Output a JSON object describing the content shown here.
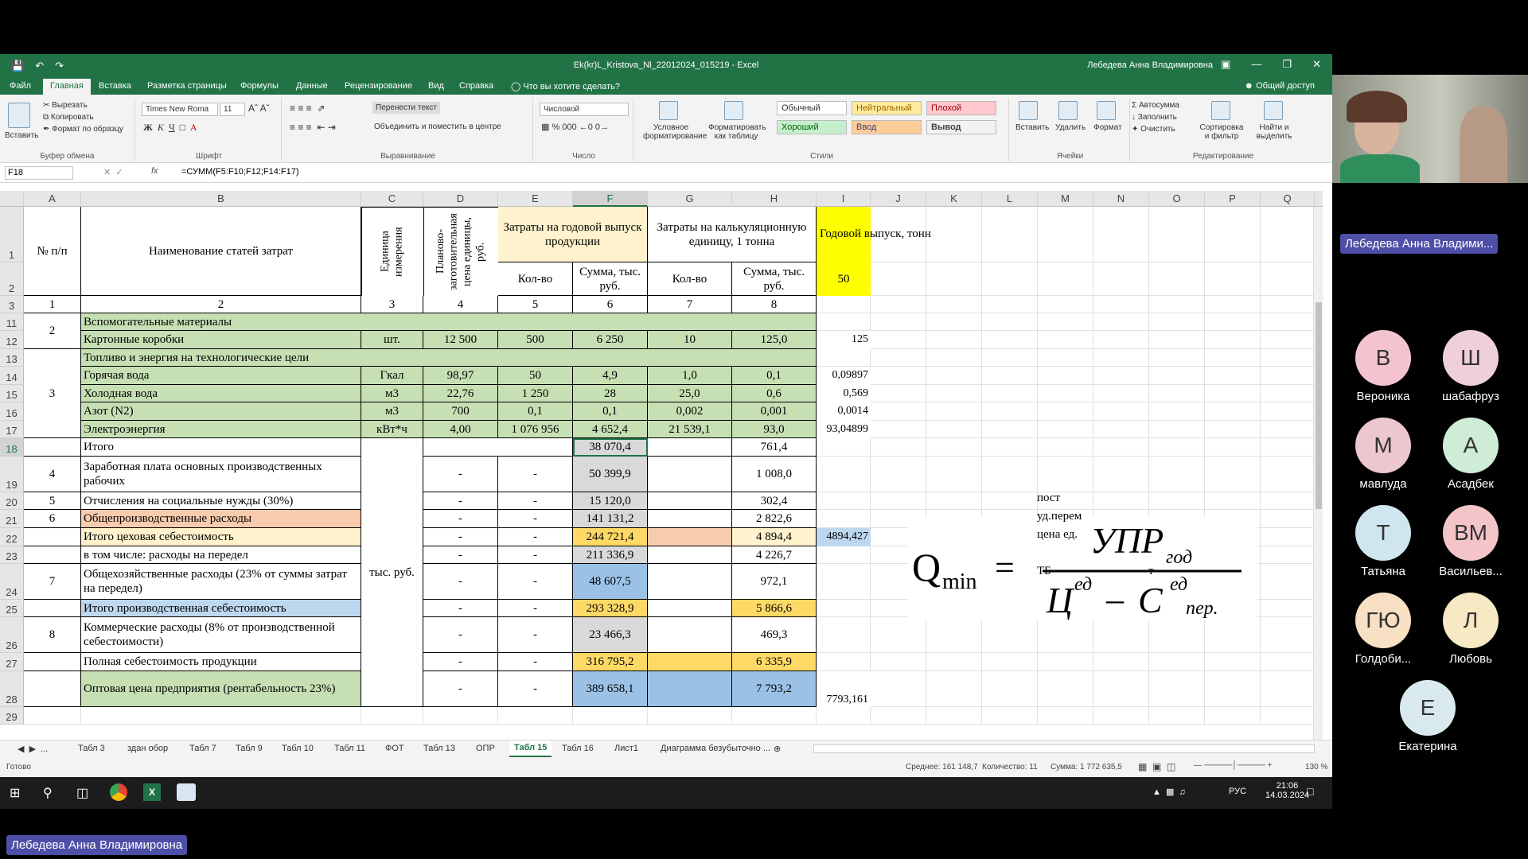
{
  "window": {
    "title": "Ek(kr)L_Kristova_Nl_22012024_015219  -  Excel",
    "user": "Лебедева Анна Владимировна"
  },
  "menu_tabs": [
    "Файл",
    "Главная",
    "Вставка",
    "Разметка страницы",
    "Формулы",
    "Данные",
    "Рецензирование",
    "Вид",
    "Справка",
    "Что вы хотите сделать?"
  ],
  "share": "Общий доступ",
  "ribbon": {
    "clipboard": {
      "paste": "Вставить",
      "cut": "Вырезать",
      "copy": "Копировать",
      "format_painter": "Формат по образцу",
      "label": "Буфер обмена"
    },
    "font": {
      "name": "Times New Roma",
      "size": "11",
      "label": "Шрифт"
    },
    "alignment": {
      "wrap": "Перенести текст",
      "merge": "Объединить и поместить в центре",
      "label": "Выравнивание"
    },
    "number": {
      "format": "Числовой",
      "label": "Число"
    },
    "styles": {
      "cond": "Условное форматирование",
      "table": "Форматировать как таблицу",
      "normal": "Обычный",
      "neutral": "Нейтральный",
      "bad": "Плохой",
      "good": "Хороший",
      "input": "Ввод",
      "output": "Вывод",
      "label": "Стили"
    },
    "cells": {
      "insert": "Вставить",
      "delete": "Удалить",
      "format": "Формат",
      "label": "Ячейки"
    },
    "editing": {
      "autosum": "Автосумма",
      "fill": "Заполнить",
      "clear": "Очистить",
      "sort": "Сортировка и фильтр",
      "find": "Найти и выделить",
      "label": "Редактирование"
    }
  },
  "formula_bar": {
    "cell": "F18",
    "fx": "fx",
    "formula": "=СУММ(F5:F10;F12;F14:F17)"
  },
  "columns": [
    "A",
    "B",
    "C",
    "D",
    "E",
    "F",
    "G",
    "H",
    "I",
    "J",
    "K",
    "L",
    "M",
    "N",
    "O",
    "P",
    "Q"
  ],
  "rows": [
    "1",
    "2",
    "3",
    "11",
    "12",
    "13",
    "14",
    "15",
    "16",
    "17",
    "18",
    "19",
    "20",
    "21",
    "22",
    "23",
    "24",
    "25",
    "26",
    "27",
    "28",
    "29"
  ],
  "header": {
    "a": "№ п/п",
    "b": "Наименование статей затрат",
    "c": "Единица измерения",
    "d": "Планово-заготовительная цена единицы, руб.",
    "ef": "Затраты на годовой выпуск продукции",
    "gh": "Затраты на калькуляционную единицу, 1 тонна",
    "i": "Годовой выпуск, тонн",
    "i2": "50",
    "e2": "Кол-во",
    "f2": "Сумма, тыс. руб.",
    "g2": "Кол-во",
    "h2": "Сумма, тыс. руб.",
    "nums": [
      "1",
      "2",
      "3",
      "4",
      "5",
      "6",
      "7",
      "8"
    ]
  },
  "table": [
    {
      "a": "2",
      "b": "Вспомогательные материалы"
    },
    {
      "b": "Картонные коробки",
      "c": "шт.",
      "d": "12 500",
      "e": "500",
      "f": "6 250",
      "g": "10",
      "h": "125,0",
      "i": "125"
    },
    {
      "b": "Топливо и энергия на технологические цели"
    },
    {
      "a": "3",
      "b": "Горячая вода",
      "c": "Гкал",
      "d": "98,97",
      "e": "50",
      "f": "4,9",
      "g": "1,0",
      "h": "0,1",
      "i": "0,09897"
    },
    {
      "b": "Холодная вода",
      "c": "м3",
      "d": "22,76",
      "e": "1 250",
      "f": "28",
      "g": "25,0",
      "h": "0,6",
      "i": "0,569"
    },
    {
      "b": "Азот (N2)",
      "c": "м3",
      "d": "700",
      "e": "0,1",
      "f": "0,1",
      "g": "0,002",
      "h": "0,001",
      "i": "0,0014"
    },
    {
      "b": "Электроэнергия",
      "c": "кВт*ч",
      "d": "4,00",
      "e": "1 076 956",
      "f": "4 652,4",
      "g": "21 539,1",
      "h": "93,0",
      "i": "93,04899"
    },
    {
      "b": "Итого",
      "f": "38 070,4",
      "h": "761,4"
    },
    {
      "a": "4",
      "b": "Заработная плата основных производственных рабочих",
      "d": "-",
      "e": "-",
      "f": "50 399,9",
      "h": "1 008,0"
    },
    {
      "a": "5",
      "b": "Отчисления на социальные нужды  (30%)",
      "d": "-",
      "e": "-",
      "f": "15 120,0",
      "h": "302,4"
    },
    {
      "a": "6",
      "b": "Общепроизводственные расходы",
      "d": "-",
      "e": "-",
      "f": "141 131,2",
      "h": "2 822,6"
    },
    {
      "b": "Итого цеховая себестоимость",
      "d": "-",
      "e": "-",
      "f": "244 721,4",
      "h": "4 894,4",
      "i": "4894,427"
    },
    {
      "b": "в том числе: расходы на передел",
      "d": "-",
      "e": "-",
      "f": "211 336,9",
      "h": "4 226,7"
    },
    {
      "a": "7",
      "b": "Общехозяйственные расходы (23% от суммы затрат на передел)",
      "c": "тыс. руб.",
      "d": "-",
      "e": "-",
      "f": "48 607,5",
      "h": "972,1"
    },
    {
      "b": "Итого производственная себестоимость",
      "d": "-",
      "e": "-",
      "f": "293 328,9",
      "h": "5 866,6"
    },
    {
      "a": "8",
      "b": "Коммерческие расходы (8% от производственной себестоимости)",
      "d": "-",
      "e": "-",
      "f": "23 466,3",
      "h": "469,3"
    },
    {
      "b": "Полная себестоимость продукции",
      "d": "-",
      "e": "-",
      "f": "316 795,2",
      "h": "6 335,9"
    },
    {
      "b": "Оптовая цена предприятия (рентабельность 23%)",
      "d": "-",
      "e": "-",
      "f": "389 658,1",
      "h": "7 793,2",
      "i": "7793,161"
    }
  ],
  "notes": {
    "post": "пост",
    "ud": "уд.перем",
    "price": "цена ед.",
    "tb": "ТБ",
    "t": "т"
  },
  "formula": {
    "q": "Q",
    "min": "min",
    "num": "УПР",
    "num_sub": "год",
    "c1": "Ц",
    "c1_sup": "ед",
    "minus": "–",
    "c2": "С",
    "c2_sup": "ед",
    "c2_sub": "пер."
  },
  "sheets": [
    "Табл 3",
    "здан обор",
    "Табл 7",
    "Табл 9",
    "Табл 10",
    "Табл 11",
    "ФОТ",
    "Табл 13",
    "ОПР",
    "Табл 15",
    "Табл 16",
    "Лист1",
    "Диаграмма безубыточно ..."
  ],
  "status": {
    "ready": "Готово",
    "avg": "Среднее: 161 148,7",
    "count": "Количество: 11",
    "sum": "Сумма: 1 772 635,5",
    "zoom": "130 %"
  },
  "tray": {
    "lang": "РУС",
    "time": "21:06",
    "date": "14.03.2024"
  },
  "panel": {
    "speaker": "Лебедева Анна Владими...",
    "participants": [
      {
        "initial": "В",
        "name": "Вероника",
        "color": "#f3c4cf"
      },
      {
        "initial": "Ш",
        "name": "шабафруз",
        "color": "#efcfd8"
      },
      {
        "initial": "М",
        "name": "мавлуда",
        "color": "#ecc7cd"
      },
      {
        "initial": "А",
        "name": "Асадбек",
        "color": "#cfecd6"
      },
      {
        "initial": "Т",
        "name": "Татьяна",
        "color": "#cfe6ee"
      },
      {
        "initial": "ВМ",
        "name": "Васильев...",
        "color": "#f3c4c8"
      },
      {
        "initial": "ГЮ",
        "name": "Голдоби...",
        "color": "#f7e0c3"
      },
      {
        "initial": "Л",
        "name": "Любовь",
        "color": "#f7e9c3"
      },
      {
        "initial": "Е",
        "name": "Екатерина",
        "color": "#d9eaee"
      }
    ]
  },
  "bottom_name": "Лебедева Анна Владимировна"
}
